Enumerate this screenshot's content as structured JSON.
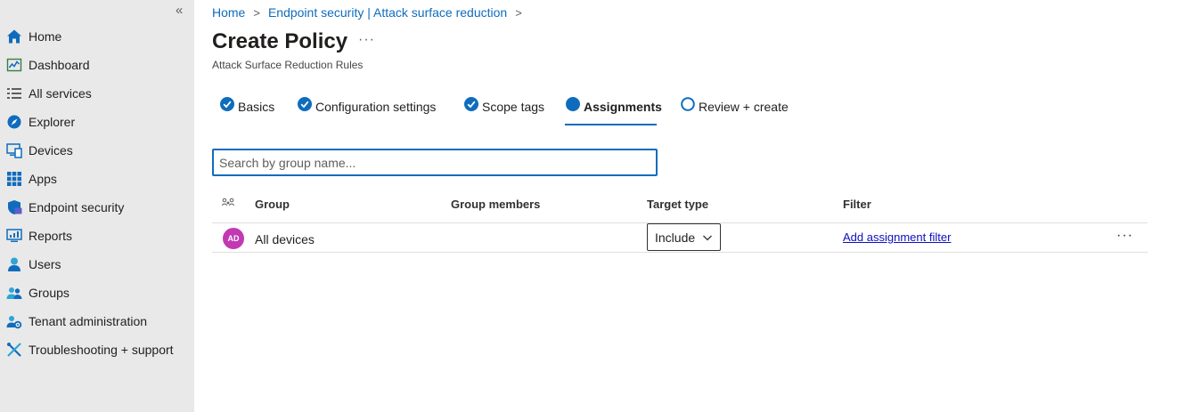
{
  "sidebar": {
    "collapse_glyph": "«",
    "items": [
      {
        "label": "Home",
        "icon": "home-icon"
      },
      {
        "label": "Dashboard",
        "icon": "dashboard-icon"
      },
      {
        "label": "All services",
        "icon": "list-icon"
      },
      {
        "label": "Explorer",
        "icon": "explorer-icon"
      },
      {
        "label": "Devices",
        "icon": "devices-icon"
      },
      {
        "label": "Apps",
        "icon": "apps-grid-icon"
      },
      {
        "label": "Endpoint security",
        "icon": "shield-icon"
      },
      {
        "label": "Reports",
        "icon": "reports-icon"
      },
      {
        "label": "Users",
        "icon": "user-icon"
      },
      {
        "label": "Groups",
        "icon": "groups-icon"
      },
      {
        "label": "Tenant administration",
        "icon": "tenant-admin-icon"
      },
      {
        "label": "Troubleshooting + support",
        "icon": "troubleshooting-icon"
      }
    ]
  },
  "breadcrumb": {
    "home": "Home",
    "section": "Endpoint security | Attack surface reduction",
    "separator": ">"
  },
  "page": {
    "title": "Create Policy",
    "more": "···",
    "subtitle": "Attack Surface Reduction Rules"
  },
  "wizard": {
    "tabs": [
      {
        "label": "Basics",
        "state": "complete"
      },
      {
        "label": "Configuration settings",
        "state": "complete"
      },
      {
        "label": "Scope tags",
        "state": "complete"
      },
      {
        "label": "Assignments",
        "state": "active"
      },
      {
        "label": "Review + create",
        "state": "pending"
      }
    ]
  },
  "search": {
    "placeholder": "Search by group name...",
    "value": ""
  },
  "table": {
    "columns": {
      "group": "Group",
      "members": "Group members",
      "target_type": "Target type",
      "filter": "Filter"
    },
    "rows": [
      {
        "avatar_initials": "AD",
        "avatar_color": "#c239b3",
        "group": "All devices",
        "members": "",
        "target_type": "Include",
        "filter_link": "Add assignment filter",
        "more": "···"
      }
    ]
  },
  "colors": {
    "accent": "#0f6cbd",
    "sidebar_bg": "#e9e9e9"
  }
}
